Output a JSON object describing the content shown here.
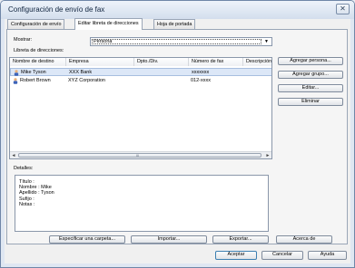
{
  "window": {
    "title": "Configuración de envío de fax",
    "close_glyph": "✕"
  },
  "tabs": [
    {
      "label": "Configuración de envío"
    },
    {
      "label": "Editar libreta de direcciones"
    },
    {
      "label": "Hoja de portada"
    }
  ],
  "show": {
    "label": "Mostrar:",
    "selected": "Persona",
    "arrow": "▼"
  },
  "address_book": {
    "label": "Libreta de direcciones:",
    "columns": [
      "Nombre de destino",
      "Empresa",
      "Dpto./Div.",
      "Número de fax",
      "Descripción"
    ],
    "rows": [
      {
        "name": "Mike Tyson",
        "company": "XXX Bank",
        "dept": "",
        "fax": "xxxxxxx",
        "description": ""
      },
      {
        "name": "Robert Brown",
        "company": "XYZ Corporation",
        "dept": "",
        "fax": "012-xxxx",
        "description": ""
      }
    ],
    "scroll_left": "◄",
    "scroll_right": "►",
    "scroll_grip": "III"
  },
  "side_buttons": {
    "add_person": "Agregar persona...",
    "add_group": "Agregar grupo...",
    "edit": "Editar...",
    "delete": "Eliminar"
  },
  "details": {
    "label": "Detalles:",
    "lines": [
      "Título :",
      "Nombre : Mike",
      "Apellido : Tyson",
      "Sufijo :",
      "Notas :"
    ]
  },
  "bottom_buttons": {
    "specify_folder": "Especificar una carpeta...",
    "import": "Importar...",
    "export": "Exportar...",
    "about": "Acerca de"
  },
  "dialog_buttons": {
    "ok": "Aceptar",
    "cancel": "Cancelar",
    "help": "Ayuda"
  },
  "colors": {
    "selected_row": "#dce7f7",
    "title_text": "#10243f"
  }
}
